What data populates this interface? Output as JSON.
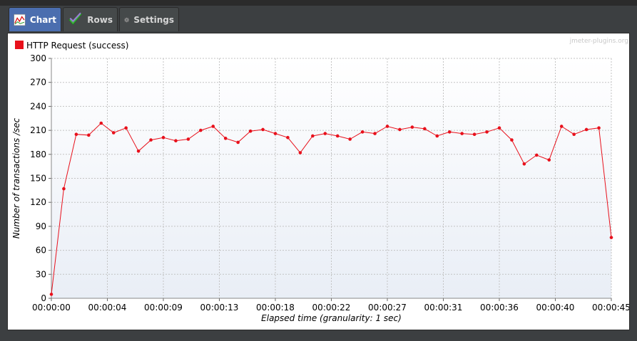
{
  "tabs": [
    {
      "label": "Chart",
      "icon": "chart-icon",
      "active": true
    },
    {
      "label": "Rows",
      "icon": "checkmark-icon",
      "active": false
    },
    {
      "label": "Settings",
      "icon": "gear-icon",
      "active": false
    }
  ],
  "watermark": "jmeter-plugins.org",
  "colors": {
    "series": "#e8101b",
    "plot_bg_top": "#ffffff",
    "plot_bg_bottom": "#e9eef6",
    "grid": "#c3c3c3",
    "active_tab": "#4b6eaf"
  },
  "chart_data": {
    "type": "line",
    "xlabel": "Elapsed time (granularity: 1 sec)",
    "ylabel": "Number of transactions /sec",
    "xlim": [
      0,
      45
    ],
    "ylim": [
      0,
      300
    ],
    "x_ticks": [
      0,
      4.5,
      9,
      13.5,
      18,
      22.5,
      27,
      31.5,
      36,
      40.5,
      45
    ],
    "x_tick_labels": [
      "00:00:00",
      "00:00:04",
      "00:00:09",
      "00:00:13",
      "00:00:18",
      "00:00:22",
      "00:00:27",
      "00:00:31",
      "00:00:36",
      "00:00:40",
      "00:00:45"
    ],
    "y_ticks": [
      0,
      30,
      60,
      90,
      120,
      150,
      180,
      210,
      240,
      270,
      300
    ],
    "y_tick_labels": [
      "0",
      "30",
      "60",
      "90",
      "120",
      "150",
      "180",
      "210",
      "240",
      "270",
      "300"
    ],
    "grid": true,
    "legend_position": "top-left",
    "series": [
      {
        "name": "HTTP Request (success)",
        "color": "#e8101b",
        "x": [
          0,
          1,
          2,
          3,
          4,
          5,
          6,
          7,
          8,
          9,
          10,
          11,
          12,
          13,
          14,
          15,
          16,
          17,
          18,
          19,
          20,
          21,
          22,
          23,
          24,
          25,
          26,
          27,
          28,
          29,
          30,
          31,
          32,
          33,
          34,
          35,
          36,
          37,
          38,
          39,
          40,
          41,
          42,
          43,
          44,
          45
        ],
        "values": [
          5,
          137,
          205,
          204,
          219,
          207,
          213,
          184,
          198,
          201,
          197,
          199,
          210,
          215,
          200,
          195,
          209,
          211,
          206,
          201,
          182,
          203,
          206,
          203,
          199,
          208,
          206,
          215,
          211,
          214,
          212,
          203,
          208,
          206,
          205,
          208,
          213,
          198,
          168,
          179,
          173,
          215,
          205,
          211,
          213,
          76
        ]
      }
    ]
  }
}
